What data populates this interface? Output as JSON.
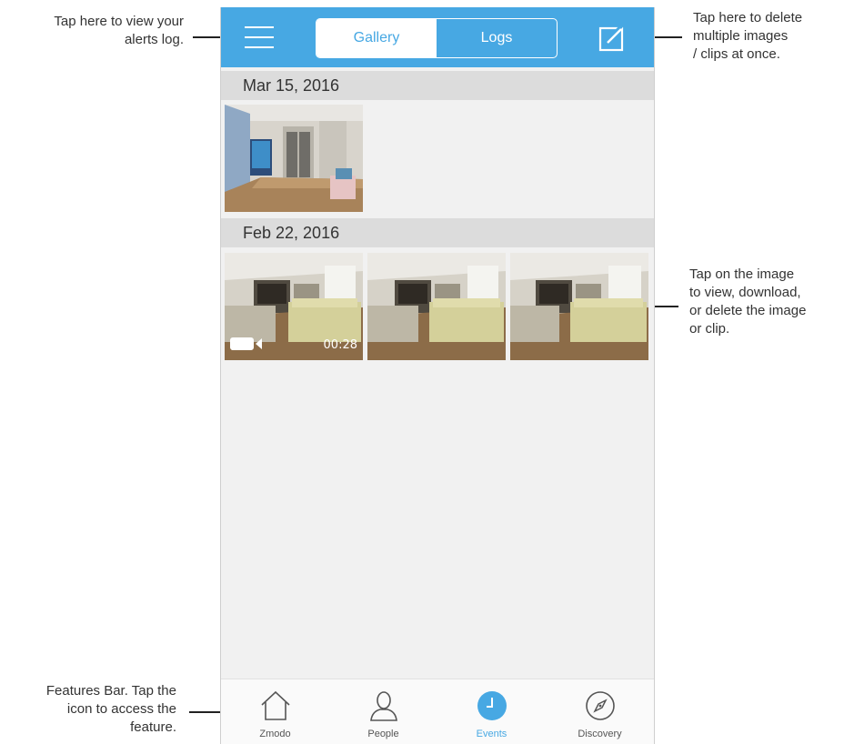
{
  "topbar": {
    "tabs": [
      {
        "label": "Gallery",
        "active": true
      },
      {
        "label": "Logs",
        "active": false
      }
    ]
  },
  "groups": [
    {
      "date": "Mar 15, 2016",
      "thumbs": [
        {
          "duration": ""
        }
      ]
    },
    {
      "date": "Feb 22, 2016",
      "thumbs": [
        {
          "duration": "00:28"
        },
        {
          "duration": ""
        },
        {
          "duration": ""
        }
      ]
    }
  ],
  "navbar": {
    "items": [
      {
        "label": "Zmodo",
        "icon": "home-icon"
      },
      {
        "label": "People",
        "icon": "person-icon"
      },
      {
        "label": "Events",
        "icon": "clock-icon",
        "active": true
      },
      {
        "label": "Discovery",
        "icon": "compass-icon"
      }
    ]
  },
  "annotations": {
    "logs": [
      "Tap here to view your",
      "alerts log."
    ],
    "delete": [
      "Tap here to delete",
      "multiple images",
      "/ clips at once."
    ],
    "image": [
      "Tap on the image",
      "to view, download,",
      "or delete the image",
      "or clip."
    ],
    "features": [
      "Features Bar. Tap the",
      "icon to access the",
      "feature."
    ]
  },
  "colors": {
    "accent": "#47a8e3",
    "background": "#f1f1f1",
    "date_header": "#dcdcdc"
  }
}
